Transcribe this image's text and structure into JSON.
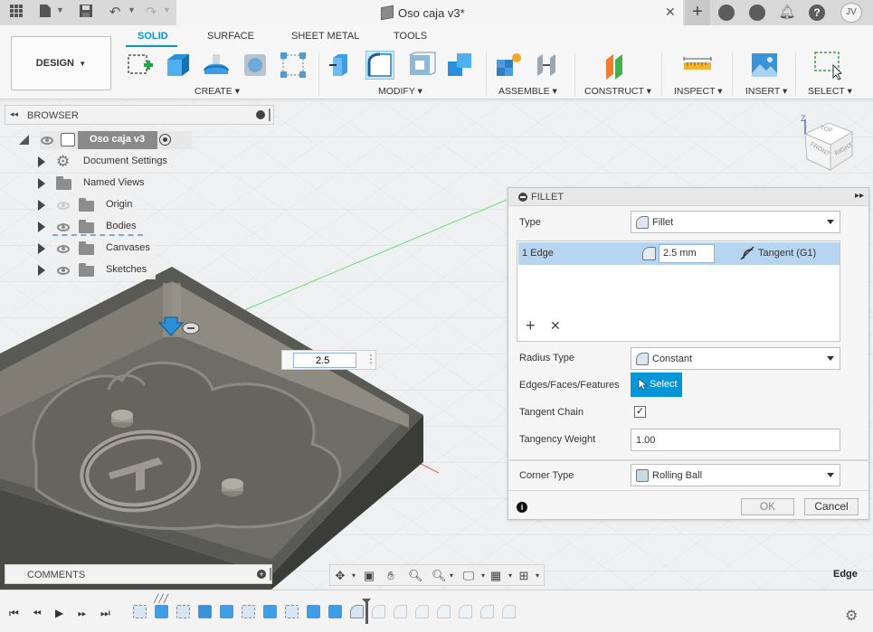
{
  "title_bar": {
    "document_title": "Oso caja v3*",
    "avatar_initials": "JV",
    "icons": [
      "app-grid-icon",
      "file-icon",
      "save-icon",
      "undo-icon",
      "redo-icon",
      "close-icon",
      "plus-icon",
      "extensions-icon",
      "history-icon",
      "bell-icon",
      "help-icon"
    ]
  },
  "toolbar": {
    "workspace_label": "DESIGN",
    "tabs": [
      "SOLID",
      "SURFACE",
      "SHEET METAL",
      "TOOLS"
    ],
    "active_tab": "SOLID",
    "groups": [
      "CREATE",
      "MODIFY",
      "ASSEMBLE",
      "CONSTRUCT",
      "INSPECT",
      "INSERT",
      "SELECT"
    ],
    "accent_color": "#0696d7"
  },
  "browser": {
    "title": "BROWSER",
    "root": "Oso caja v3",
    "items": [
      "Document Settings",
      "Named Views",
      "Origin",
      "Bodies",
      "Canvases",
      "Sketches"
    ]
  },
  "viewport": {
    "radius_input_value": "2.5"
  },
  "fillet_panel": {
    "title": "FILLET",
    "type_label": "Type",
    "type_value": "Fillet",
    "edge_row": {
      "selection": "1 Edge",
      "radius": "2.5 mm",
      "continuity": "Tangent (G1)"
    },
    "radius_type_label": "Radius Type",
    "radius_type_value": "Constant",
    "edges_label": "Edges/Faces/Features",
    "select_button": "Select",
    "tangent_chain_label": "Tangent Chain",
    "tangent_chain_checked": true,
    "tangency_weight_label": "Tangency Weight",
    "tangency_weight_value": "1.00",
    "corner_type_label": "Corner Type",
    "corner_type_value": "Rolling Ball",
    "ok_button": "OK",
    "cancel_button": "Cancel"
  },
  "comments": {
    "title": "COMMENTS"
  },
  "status": {
    "selection_filter": "Edge"
  },
  "viewcube": {
    "top": "TOP",
    "front": "FRONT",
    "right": "RIGHT",
    "axis_z": "Z"
  }
}
